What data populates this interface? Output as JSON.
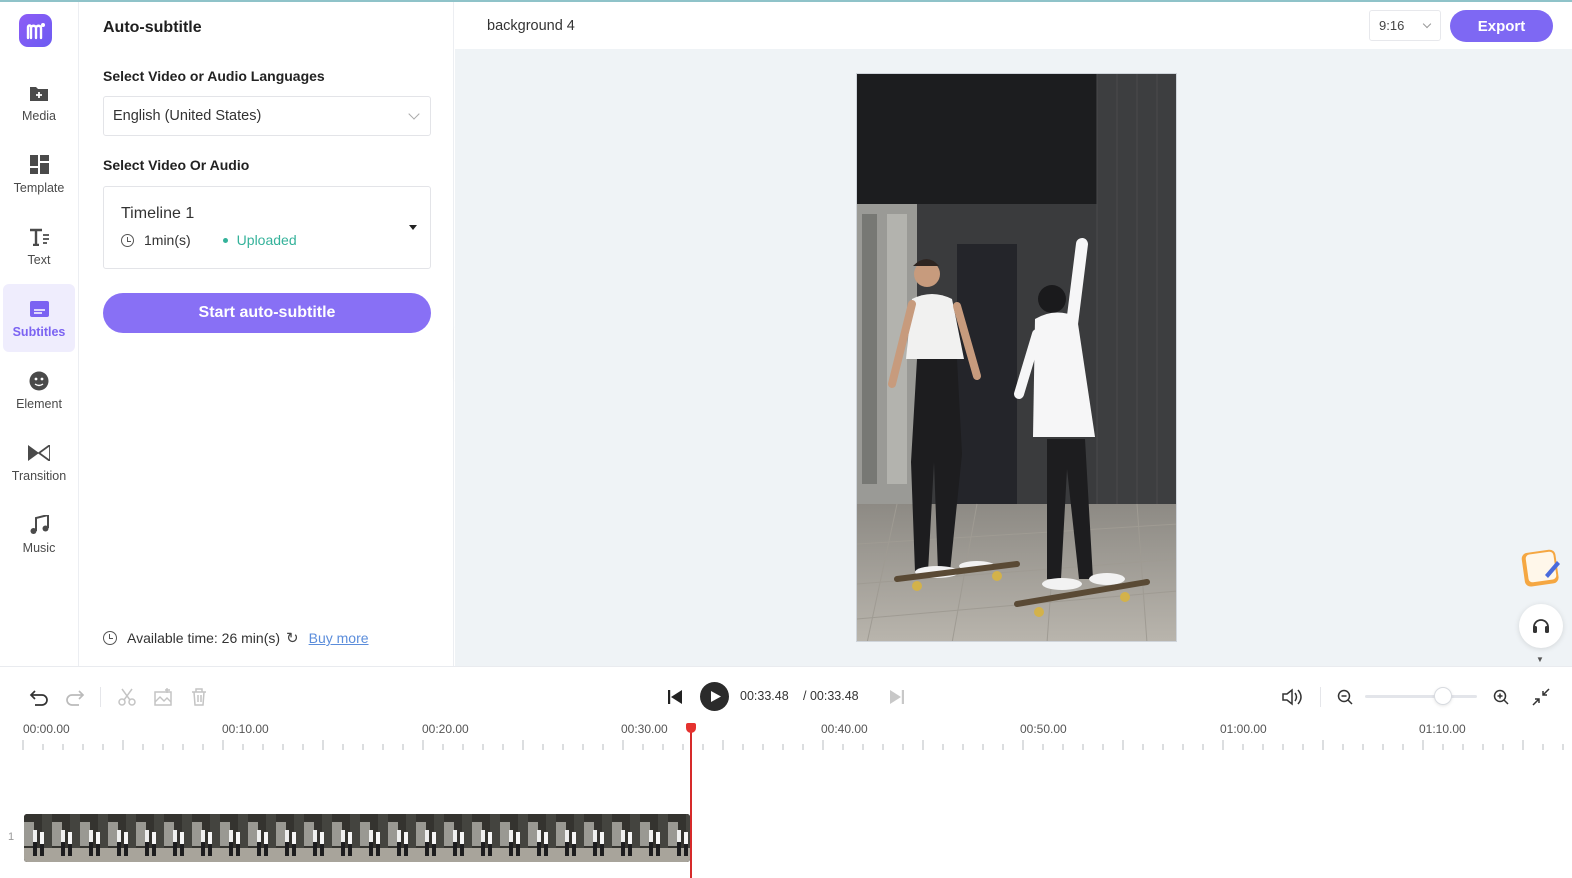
{
  "app": {
    "accent": "#7e68f3",
    "logo_icon": "logo-m-icon"
  },
  "rail": {
    "items": [
      {
        "label": "Media",
        "icon": "media-add-icon"
      },
      {
        "label": "Template",
        "icon": "template-grid-icon"
      },
      {
        "label": "Text",
        "icon": "text-icon"
      },
      {
        "label": "Subtitles",
        "icon": "subtitles-icon",
        "active": true
      },
      {
        "label": "Element",
        "icon": "element-icon"
      },
      {
        "label": "Transition",
        "icon": "transition-icon"
      },
      {
        "label": "Music",
        "icon": "music-icon"
      }
    ]
  },
  "panel": {
    "title": "Auto-subtitle",
    "language_label": "Select Video or Audio Languages",
    "language_value": "English (United States)",
    "source_label": "Select Video Or Audio",
    "source": {
      "name": "Timeline 1",
      "duration": "1min(s)",
      "status": "Uploaded"
    },
    "start_button": "Start auto-subtitle",
    "available_text": "Available time: 26 min(s)",
    "buy_more": "Buy more"
  },
  "header": {
    "project_name": "background 4",
    "ratio": "9:16",
    "export_label": "Export"
  },
  "timeline": {
    "current_time": "00:33.48",
    "total_time": "/ 00:33.48",
    "ruler_labels": [
      "00:00.00",
      "00:10.00",
      "00:20.00",
      "00:30.00",
      "00:40.00",
      "00:50.00",
      "01:00.00",
      "01:10.00"
    ],
    "track_number": "1"
  }
}
